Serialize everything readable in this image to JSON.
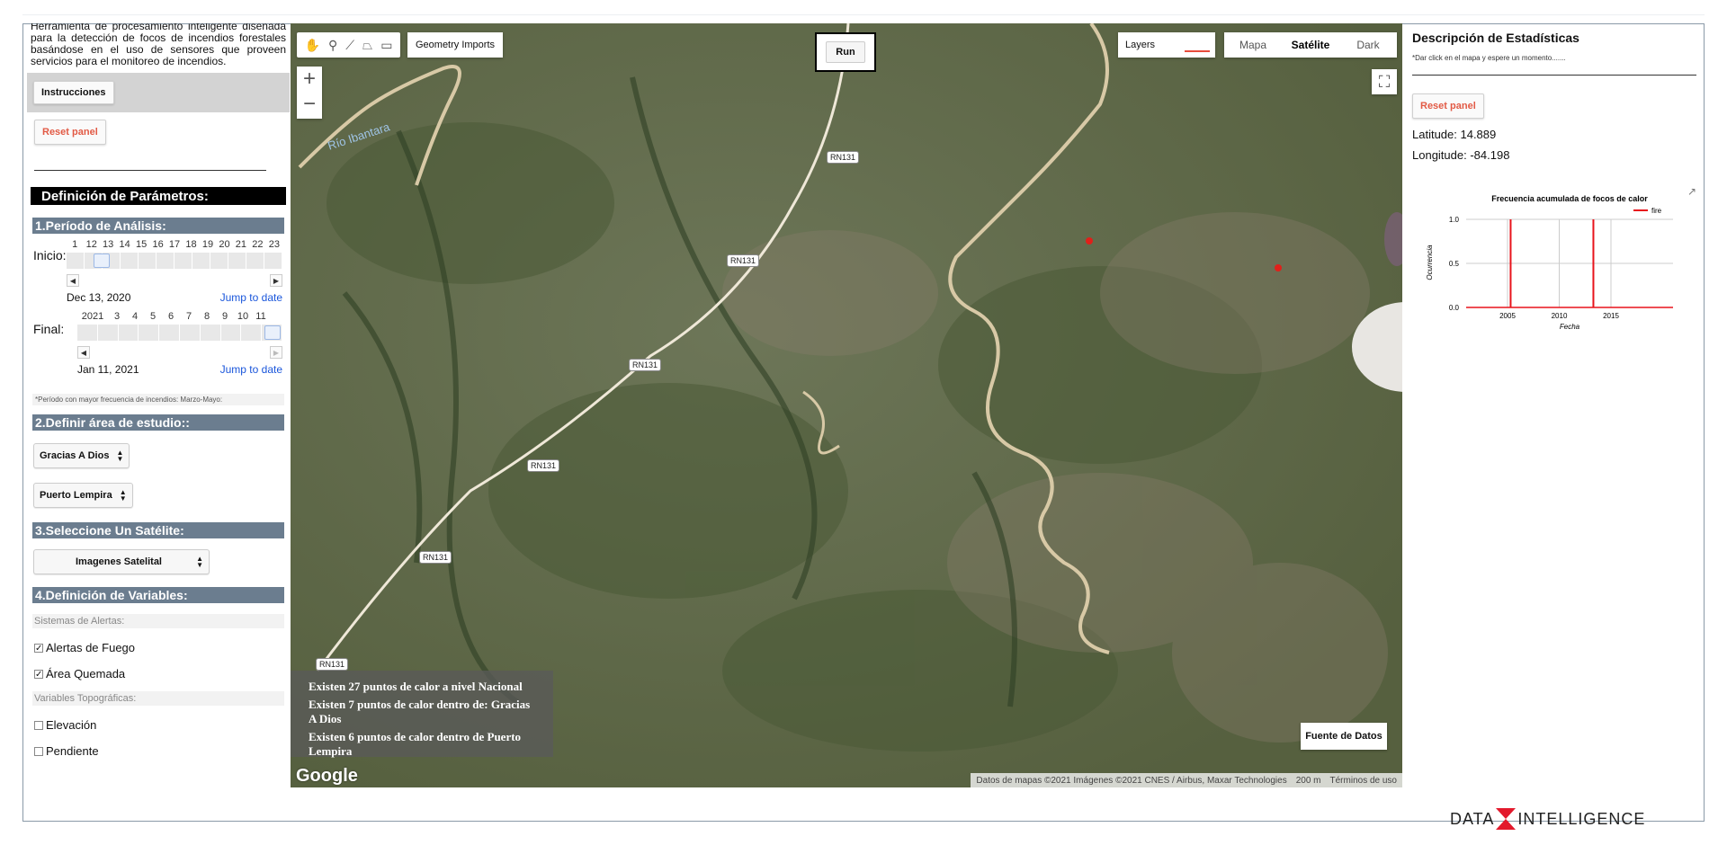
{
  "left": {
    "intro": "Herramienta de procesamiento inteligente diseñada para la detección de focos de incendios forestales basándose en el uso de sensores que proveen servicios para el monitoreo de incendios.",
    "instructions_button": "Instrucciones",
    "reset_button": "Reset panel",
    "params_title": "Definición de Parámetros:",
    "period_title": "1.Período de Análisis:",
    "start": {
      "label": "Inicio:",
      "ticks": [
        "1",
        "12",
        "13",
        "14",
        "15",
        "16",
        "17",
        "18",
        "19",
        "20",
        "21",
        "22",
        "23"
      ],
      "date": "Dec 13, 2020",
      "jump": "Jump to date"
    },
    "end": {
      "label": "Final:",
      "ticks": [
        "2021",
        "3",
        "4",
        "5",
        "6",
        "7",
        "8",
        "9",
        "10",
        "11"
      ],
      "date": "Jan 11, 2021",
      "jump": "Jump to date"
    },
    "period_note": "*Período con mayor frecuencia de incendios: Marzo-Mayo:",
    "area_title": "2.Definir área de estudio::",
    "department_select": "Gracias A Dios",
    "municipality_select": "Puerto Lempira",
    "satellite_title": "3.Seleccione Un Satélite:",
    "satellite_select": "Imagenes Satelital",
    "variables_title": "4.Definición de Variables:",
    "alerts_heading": "Sistemas de Alertas:",
    "fire_alerts": "Alertas de Fuego",
    "burned_area": "Área Quemada",
    "topo_heading": "Variables Topográficas:",
    "elevation": "Elevación",
    "slope": "Pendiente"
  },
  "map": {
    "geometry_imports": "Geometry Imports",
    "run_button": "Run",
    "layers": "Layers",
    "map_types": [
      "Mapa",
      "Satélite",
      "Dark"
    ],
    "selected_map_type": "Satélite",
    "zoom_in": "+",
    "zoom_out": "−",
    "river_label": "Río Ibantara",
    "road_labels": [
      "RN131",
      "RN131",
      "RN131",
      "RN131",
      "RN131"
    ],
    "info": {
      "national": "Existen 27 puntos de calor a nivel Nacional",
      "department": "Existen 7 puntos de calor dentro de: Gracias A Dios",
      "municipality": "Existen 6 puntos de calor dentro de Puerto Lempira"
    },
    "data_source_button": "Fuente de Datos",
    "google": "Google",
    "attribution": "Datos de mapas ©2021 Imágenes ©2021 CNES / Airbus, Maxar Technologies",
    "scale": "200 m",
    "terms": "Términos de uso"
  },
  "right": {
    "title": "Descripción de Estadísticas",
    "hint": "*Dar click en el mapa y espere un momento.......",
    "reset_button": "Reset panel",
    "latitude": "Latitude: 14.889",
    "longitude": "Longitude: -84.198"
  },
  "chart_data": {
    "type": "line",
    "title": "Frecuencia acumulada de focos de calor",
    "xlabel": "Fecha",
    "ylabel": "Ocurrencia",
    "xlim": [
      2001,
      2021
    ],
    "ylim": [
      0,
      1
    ],
    "x_ticks": [
      "2005",
      "2010",
      "2015"
    ],
    "y_ticks": [
      "0.0",
      "0.5",
      "1.0"
    ],
    "series": [
      {
        "name": "fire",
        "color": "#e8141c",
        "spikes": [
          2005.3,
          2013.3
        ]
      }
    ],
    "legend": "top-right",
    "grid": true
  },
  "footer": {
    "logo_left": "DATA",
    "logo_right": "INTELLIGENCE"
  },
  "colors": {
    "section_header": "#6b7d8f",
    "reset_text": "#e25a45",
    "fire_marker": "#e0201a",
    "link": "#1a56db"
  }
}
